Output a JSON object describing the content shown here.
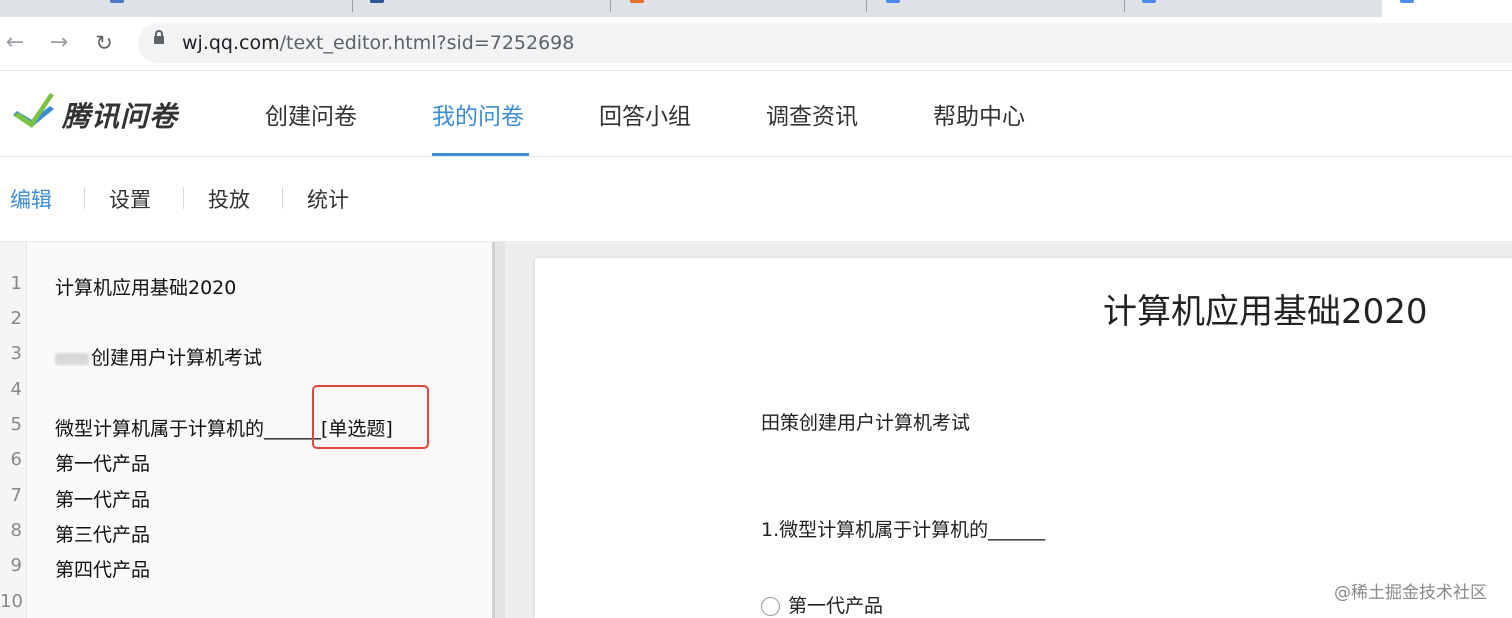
{
  "browser": {
    "url_host": "wj.qq.com",
    "url_path": "/text_editor.html?sid=7252698"
  },
  "site": {
    "logo_text": "腾讯问卷",
    "nav": [
      "创建问卷",
      "我的问卷",
      "回答小组",
      "调查资讯",
      "帮助中心"
    ],
    "nav_active": "我的问卷",
    "accent_color": "#3b8dd8"
  },
  "subtabs": [
    "编辑",
    "设置",
    "投放",
    "统计"
  ],
  "editor": {
    "line_numbers": [
      "1",
      "2",
      "3",
      "4",
      "5",
      "6",
      "7",
      "8",
      "9",
      "10"
    ],
    "lines": [
      "计算机应用基础2020",
      "",
      "创建用户计算机考试",
      "",
      "微型计算机属于计算机的______[单选题]",
      "第一代产品",
      "第一代产品",
      "第三代产品",
      "第四代产品",
      ""
    ],
    "highlighted_text": "[单选题]"
  },
  "preview": {
    "title": "计算机应用基础2020",
    "description": "田策创建用户计算机考试",
    "question": "1.微型计算机属于计算机的______",
    "option1": "第一代产品"
  },
  "watermark": "@稀土掘金技术社区"
}
